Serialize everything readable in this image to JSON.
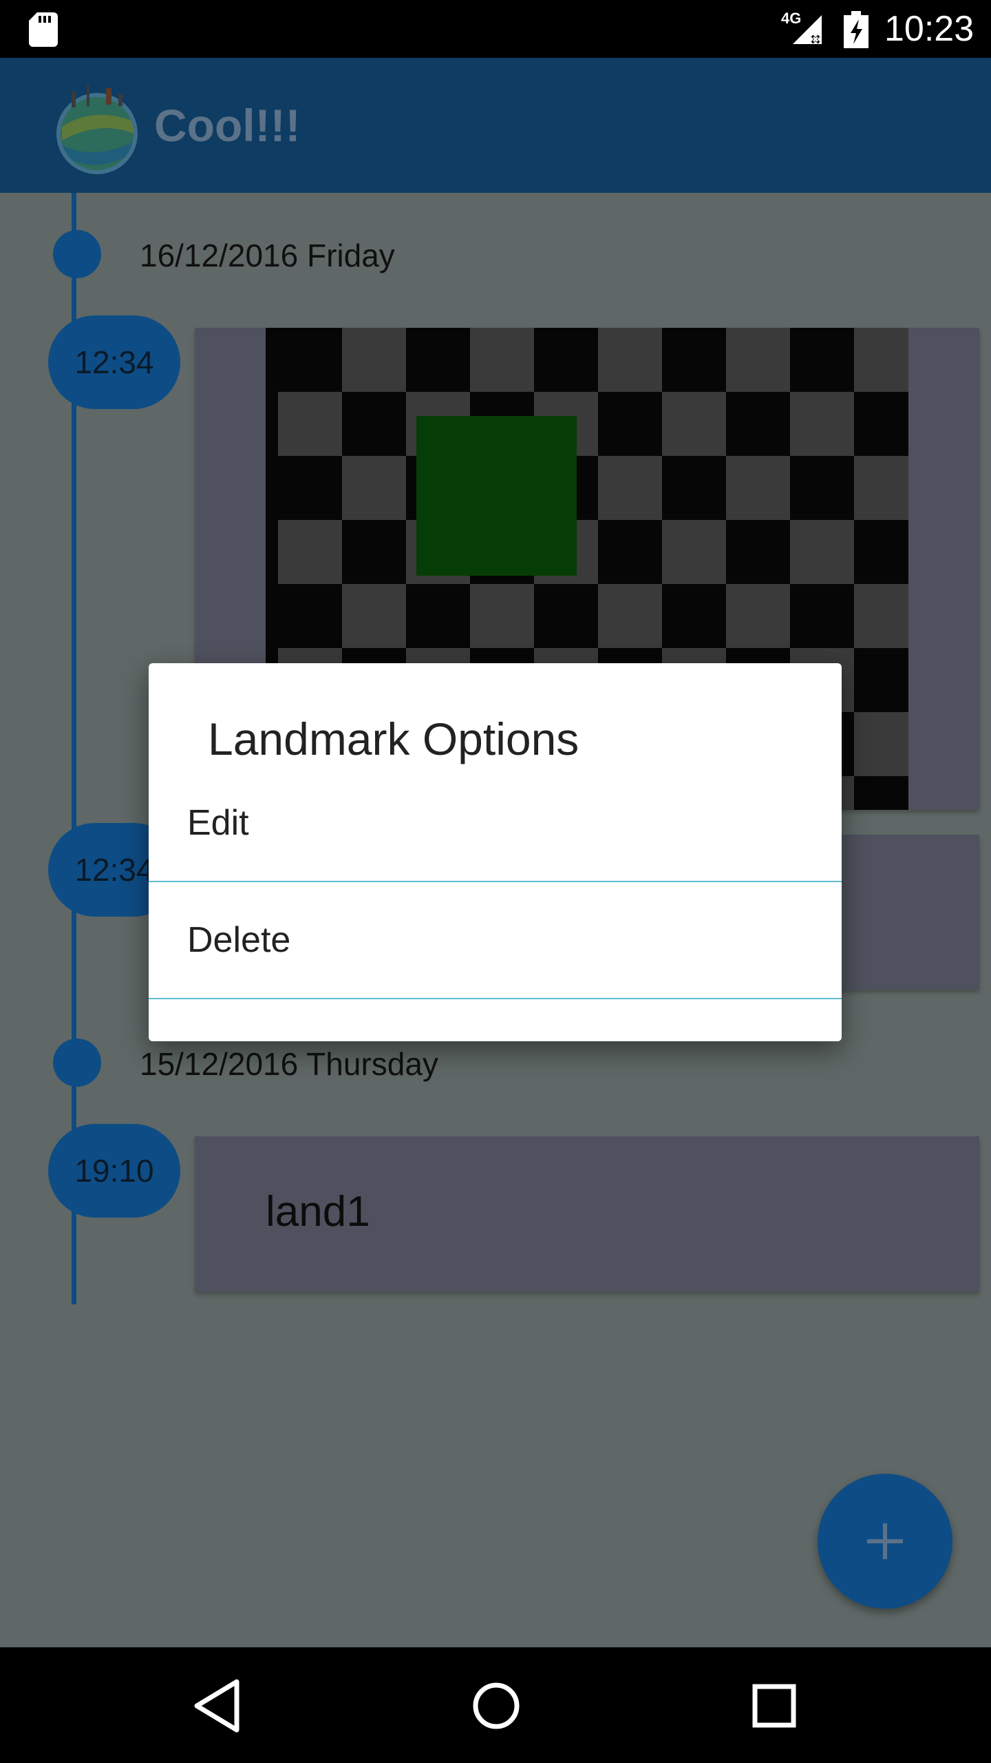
{
  "status_bar": {
    "time": "10:23",
    "network": "4G",
    "icons": [
      "sd-card-icon",
      "signal-no-data-icon",
      "battery-charging-icon"
    ]
  },
  "app_bar": {
    "title": "Cool!!!",
    "logo": "globe-logo"
  },
  "timeline": {
    "days": [
      {
        "label": "16/12/2016 Friday",
        "entries": [
          {
            "time": "12:34",
            "type": "image",
            "image": "checkerboard-placeholder"
          },
          {
            "time": "12:34",
            "type": "text",
            "label": ""
          }
        ]
      },
      {
        "label": "15/12/2016 Thursday",
        "entries": [
          {
            "time": "19:10",
            "type": "text",
            "label": "land1"
          }
        ]
      }
    ]
  },
  "dialog": {
    "title": "Landmark Options",
    "options": [
      "Edit",
      "Delete"
    ]
  },
  "fab": {
    "icon": "plus-icon"
  },
  "nav_bar": {
    "buttons": [
      "back-icon",
      "home-icon",
      "recents-icon"
    ]
  },
  "colors": {
    "primary": "#1565C0",
    "scrim": "#5f6866",
    "divider": "#5fbcd3",
    "card": "#4f515e"
  }
}
